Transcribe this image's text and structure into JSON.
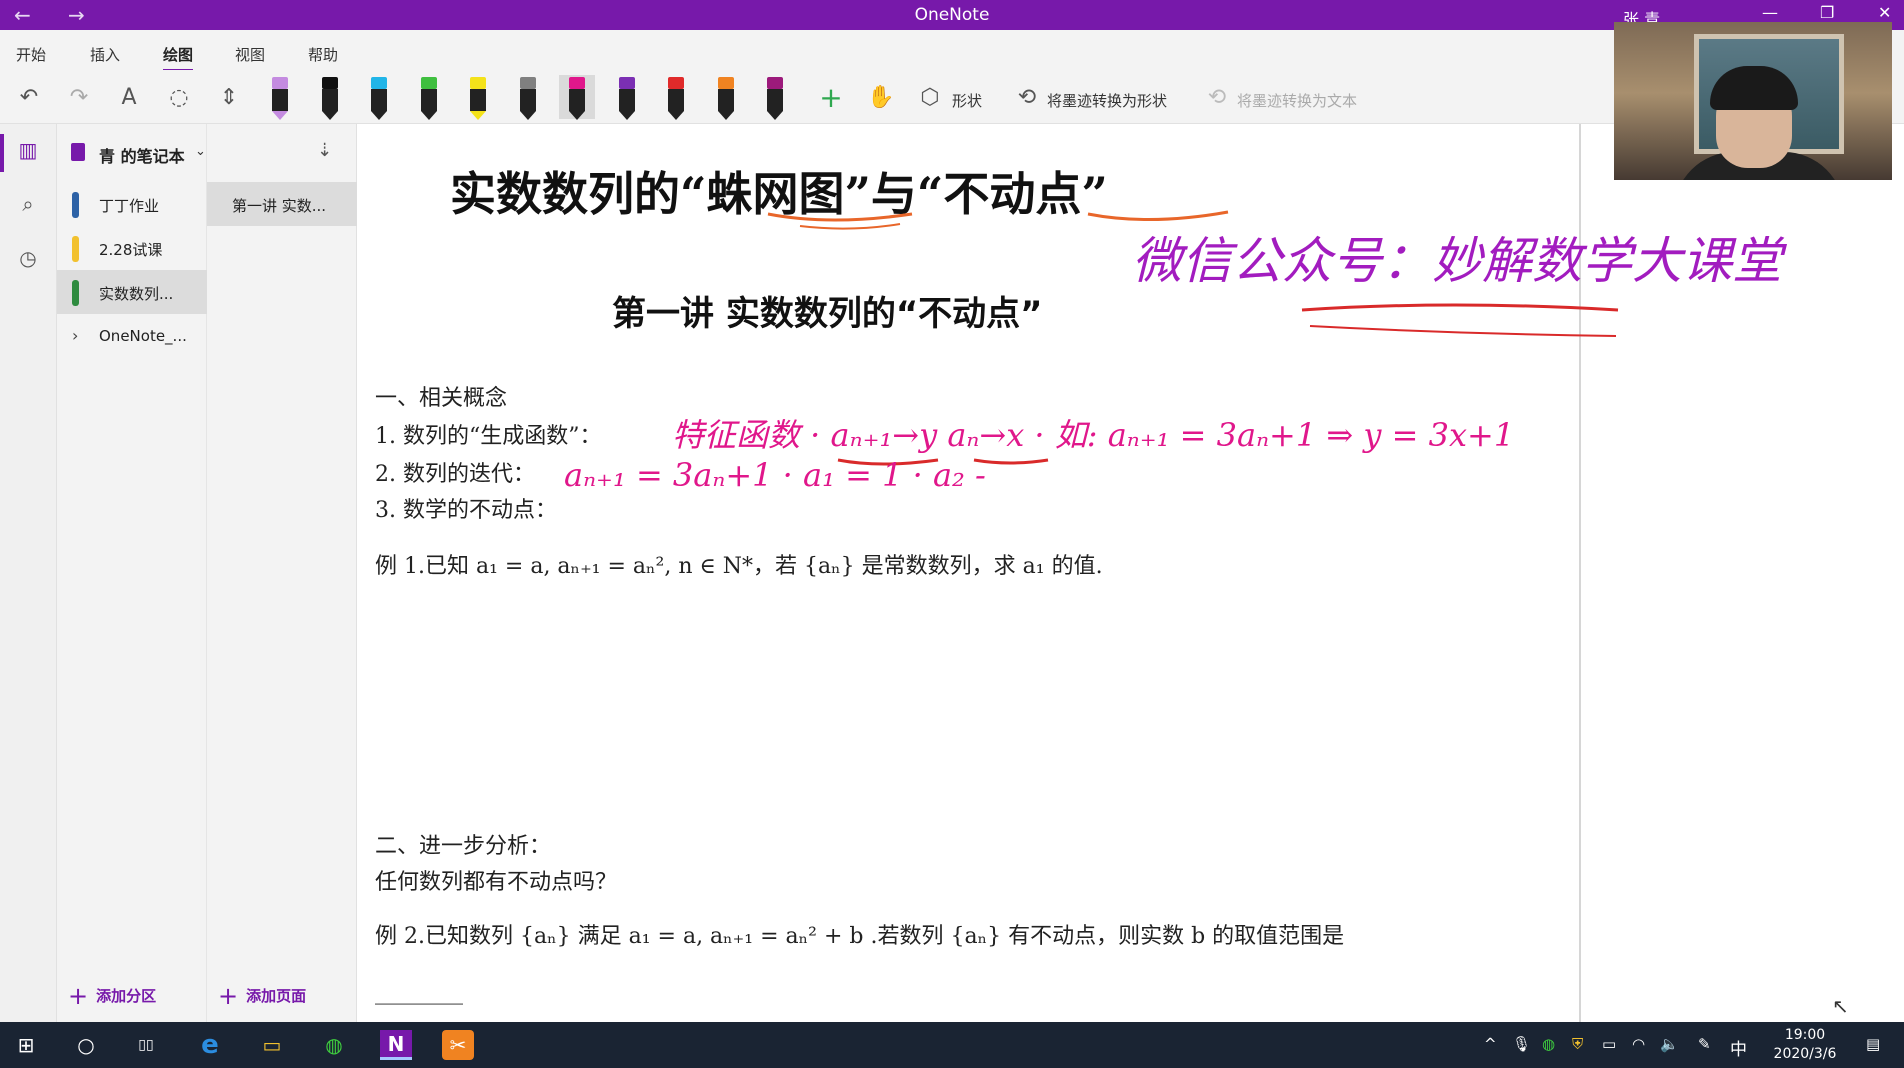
{
  "window": {
    "title": "OneNote",
    "user": "张 青",
    "back": "←",
    "forward": "→",
    "minimize": "—",
    "restore": "❐",
    "close": "✕"
  },
  "ribbon": {
    "tabs": [
      {
        "label": "开始"
      },
      {
        "label": "插入"
      },
      {
        "label": "绘图",
        "active": true
      },
      {
        "label": "视图"
      },
      {
        "label": "帮助"
      }
    ],
    "tools": {
      "undo_icon": "↶",
      "redo_icon": "↷",
      "type_icon": "A",
      "lasso_icon": "◌",
      "space_icon": "⇕",
      "add_pen_icon": "+",
      "ruler_icon": "✋",
      "shapes_label": "形状",
      "ink_to_shape_label": "将墨迹转换为形状",
      "ink_to_text_label": "将墨迹转换为文本"
    },
    "pens": [
      {
        "color": "#c48be0",
        "type": "highlighter"
      },
      {
        "color": "#111111",
        "type": "pen"
      },
      {
        "color": "#21b5e8",
        "type": "pen"
      },
      {
        "color": "#3fbf3f",
        "type": "pen"
      },
      {
        "color": "#f4e21a",
        "type": "highlighter"
      },
      {
        "color": "#808080",
        "type": "pencil"
      },
      {
        "color": "#e0178b",
        "type": "pen",
        "selected": true
      },
      {
        "color": "#7b2fb3",
        "type": "pen"
      },
      {
        "color": "#e02a2a",
        "type": "pen"
      },
      {
        "color": "#f08321",
        "type": "pen"
      },
      {
        "color": "#9c1a7b",
        "type": "pen"
      }
    ]
  },
  "nav": {
    "notebooks_icon": "▥",
    "search_icon": "⌕",
    "recent_icon": "◷"
  },
  "notebook": {
    "name": "青 的笔记本",
    "sort_icon": "⇣",
    "sections": [
      {
        "label": "丁丁作业",
        "color": "#2d62a6"
      },
      {
        "label": "2.28试课",
        "color": "#f2c12e"
      },
      {
        "label": "实数数列...",
        "color": "#2e8b3f",
        "selected": true
      },
      {
        "label": "OneNote_...",
        "color": "",
        "group": true
      }
    ],
    "pages": [
      {
        "label": "第一讲 实数..."
      }
    ],
    "add_section": "添加分区",
    "add_page": "添加页面"
  },
  "page": {
    "title": "实数数列的“蛛网图”与“不动点”",
    "subtitle": "第一讲  实数数列的“不动点”",
    "sec1_heading": "一、相关概念",
    "item1": "1.   数列的“生成函数”：",
    "item2": "2.   数列的迭代：",
    "item3": "3.   数学的不动点：",
    "ex1": "例 1.已知 a₁ = a, aₙ₊₁ = aₙ², n ∈ N*，若 {aₙ} 是常数数列，求 a₁ 的值.",
    "sec2_heading": "二、进一步分析：",
    "sec2_question": "任何数列都有不动点吗？",
    "ex2": "例 2.已知数列 {aₙ} 满足 a₁ = a, aₙ₊₁ = aₙ² + b .若数列 {aₙ} 有不动点，则实数 b 的取值范围是",
    "blank": "________"
  },
  "ink": {
    "wechat": "微信公众号：妙解数学大课堂",
    "line1": "特征函数 · aₙ₊₁→y   aₙ→x · 如: aₙ₊₁ = 3aₙ+1 ⇒ y = 3x+1",
    "line2": "aₙ₊₁ = 3aₙ+1 · a₁ = 1 · a₂ -",
    "pink": "#e0178b",
    "purple": "#a21cbf",
    "orange": "#e8662a",
    "red": "#d92a2a"
  },
  "taskbar": {
    "start_icon": "⊞",
    "search_icon": "○",
    "taskview_icon": "▯▯",
    "edge_icon": "e",
    "explorer_icon": "▭",
    "wechat_icon": "◍",
    "onenote_icon": "N",
    "app_icon": "✂",
    "tray_up": "^",
    "mic_icon": "🎙",
    "wechat_tray": "◍",
    "shield_icon": "⛨",
    "battery_icon": "▭",
    "wifi_icon": "◠",
    "volume_icon": "🔈",
    "pen_icon": "✎",
    "ime": "中",
    "time": "19:00",
    "date": "2020/3/6",
    "notification_icon": "▤"
  }
}
